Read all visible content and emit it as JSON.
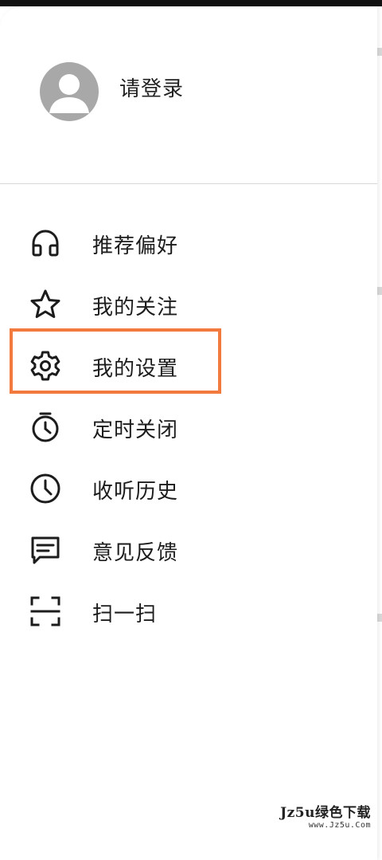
{
  "colors": {
    "accent_highlight": "#f27a3f",
    "avatar_bg": "#a8a8a8",
    "text": "#1c1c1c",
    "divider": "#d6d6d6"
  },
  "profile": {
    "login_label": "请登录",
    "avatar_icon": "user-avatar-icon"
  },
  "menu": {
    "items": [
      {
        "label": "推荐偏好",
        "icon": "headphones-icon"
      },
      {
        "label": "我的关注",
        "icon": "star-icon"
      },
      {
        "label": "我的设置",
        "icon": "gear-icon"
      },
      {
        "label": "定时关闭",
        "icon": "timer-icon"
      },
      {
        "label": "收听历史",
        "icon": "clock-icon"
      },
      {
        "label": "意见反馈",
        "icon": "message-icon"
      },
      {
        "label": "扫一扫",
        "icon": "scan-icon"
      }
    ],
    "highlighted_item": "我的设置"
  },
  "watermark": {
    "main": "Jz5u绿色下载",
    "sub": "www.Jz5u.Com"
  }
}
